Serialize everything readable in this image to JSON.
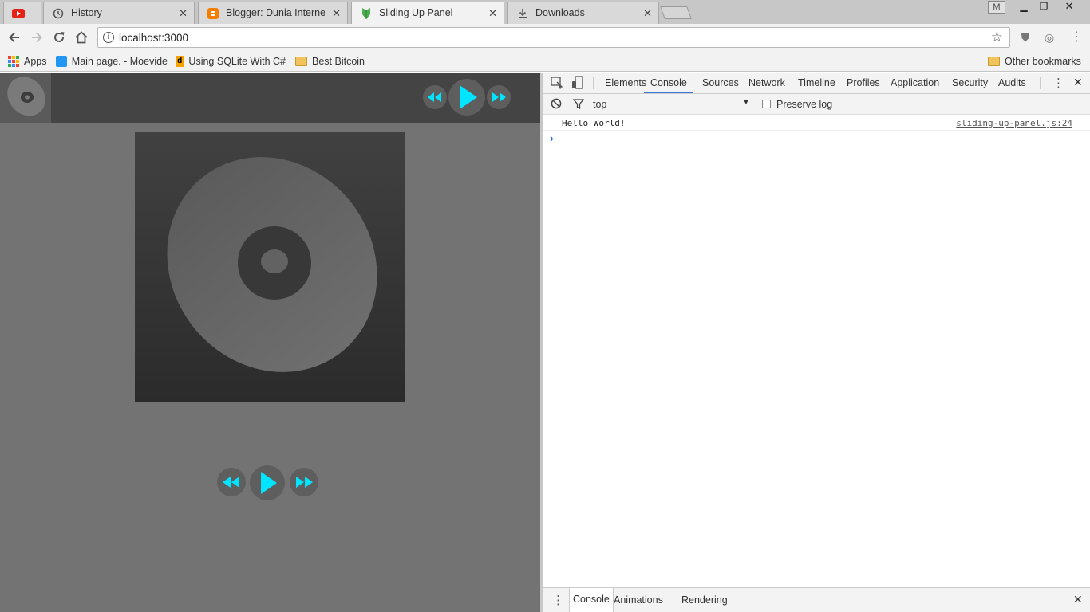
{
  "browser": {
    "tabs": [
      {
        "title": "",
        "icon": "youtube-icon"
      },
      {
        "title": "History",
        "icon": "history-icon"
      },
      {
        "title": "Blogger: Dunia Internet -",
        "icon": "blogger-icon"
      },
      {
        "title": "Sliding Up Panel",
        "icon": "polymer-icon",
        "active": true
      },
      {
        "title": "Downloads",
        "icon": "download-icon"
      }
    ],
    "profile_initial": "M",
    "address": "localhost:3000"
  },
  "bookmarks": {
    "apps": "Apps",
    "items": [
      "Main page. - Moevide",
      "Using SQLite With C#",
      "Best Bitcoin"
    ],
    "other": "Other bookmarks"
  },
  "page": {
    "accent_color": "#00e5ff"
  },
  "devtools": {
    "tabs": [
      "Elements",
      "Console",
      "Sources",
      "Network",
      "Timeline",
      "Profiles",
      "Application",
      "Security",
      "Audits"
    ],
    "active_tab": "Console",
    "context": "top",
    "preserve_log": "Preserve log",
    "messages": [
      {
        "text": "Hello World!",
        "source": "sliding-up-panel.js:24"
      }
    ],
    "prompt": "›",
    "drawer_tabs": [
      "Console",
      "Animations",
      "Rendering"
    ]
  }
}
